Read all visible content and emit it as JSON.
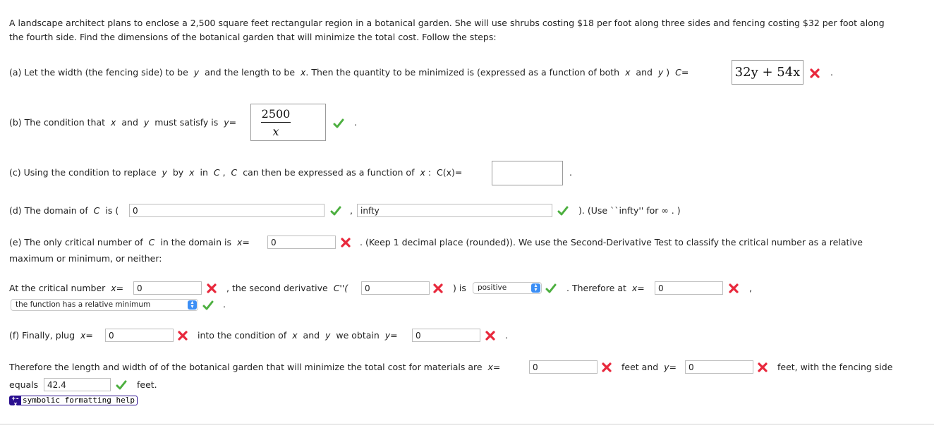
{
  "problem": {
    "line1": "A landscape architect plans to enclose a 2,500 square feet rectangular region in a botanical garden. She will use shrubs costing $18 per foot along three sides and fencing costing $32 per foot along",
    "line2": "the fourth side. Find the dimensions of the botanical garden that will minimize the total cost. Follow the steps:"
  },
  "part_a": {
    "t1": "(a) Let the width (the fencing side) to be",
    "v1": "y",
    "t2": "and the length to be",
    "v2": "x",
    "t3": ". Then the quantity to be minimized is (expressed as a function of both",
    "v3": "x",
    "t4": "and",
    "v4": "y",
    "t5": ")",
    "label": "C=",
    "answer": "32y + 54x",
    "status": "incorrect",
    "end": "."
  },
  "part_b": {
    "t1": "(b) The condition that",
    "v1": "x",
    "t2": "and",
    "v2": "y",
    "t3": "must satisfy is",
    "label": "y=",
    "numerator": "2500",
    "denominator": "x",
    "status": "correct",
    "end": "."
  },
  "part_c": {
    "t1": "(c) Using the condition to replace",
    "v1": "y",
    "t2": "by",
    "v2": "x",
    "t3": "in",
    "v3": "C",
    "t4": ",",
    "v4": "C",
    "t5": "can then be expressed as a function of",
    "v5": "x",
    "t6": ":",
    "label": "C(x)=",
    "answer": "",
    "end": "."
  },
  "part_d": {
    "t1": "(d) The domain of",
    "v1": "C",
    "t2": "is (",
    "lower": "0",
    "lower_status": "correct",
    "comma": ",",
    "upper": "infty",
    "upper_status": "correct",
    "t3": "). (Use ``infty'' for ∞ . )"
  },
  "part_e": {
    "t1": "(e) The only critical number of",
    "v1": "C",
    "t2": "in the domain is",
    "label": "x=",
    "critical": "0",
    "critical_status": "incorrect",
    "t3": ". (Keep 1 decimal place (rounded)). We use the Second-Derivative Test to classify the critical number as a relative",
    "t4": "maximum or minimum, or neither:",
    "row2_t1": "At the critical number",
    "row2_label": "x=",
    "row2_x": "0",
    "row2_x_status": "incorrect",
    "row2_t2": ", the second derivative",
    "row2_cpp": "C''(",
    "row2_cpp_value": "0",
    "row2_cpp_status": "incorrect",
    "row2_t3": ") is",
    "sign_select": "positive",
    "sign_status": "correct",
    "row2_t4": ". Therefore at",
    "row2_label2": "x=",
    "row2_x2": "0",
    "row2_x2_status": "incorrect",
    "row2_comma": ",",
    "conclusion_select": "the function has a relative minimum",
    "conclusion_status": "correct",
    "end": "."
  },
  "part_f": {
    "t1": "(f) Finally, plug",
    "label1": "x=",
    "x": "0",
    "x_status": "incorrect",
    "t2": "into the condition of",
    "v1": "x",
    "t3": "and",
    "v2": "y",
    "t4": "we obtain",
    "label2": "y=",
    "y": "0",
    "y_status": "incorrect",
    "end": "."
  },
  "final": {
    "t1": "Therefore the length and width of of the botanical garden that will minimize the total cost for materials are",
    "label_x": "x=",
    "x": "0",
    "x_status": "incorrect",
    "t2": "feet and",
    "label_y": "y=",
    "y": "0",
    "y_status": "incorrect",
    "t3": "feet, with the fencing side",
    "t4": "equals",
    "fencing": "42.4",
    "fencing_status": "correct",
    "t5": "feet."
  },
  "help_button": {
    "icon": "+-x",
    "label": "symbolic formatting help"
  },
  "colors": {
    "correct": "#4caf3f",
    "incorrect": "#e8283c",
    "help_border": "#2b0f8f",
    "select_arrow": "#3b8ef5"
  }
}
